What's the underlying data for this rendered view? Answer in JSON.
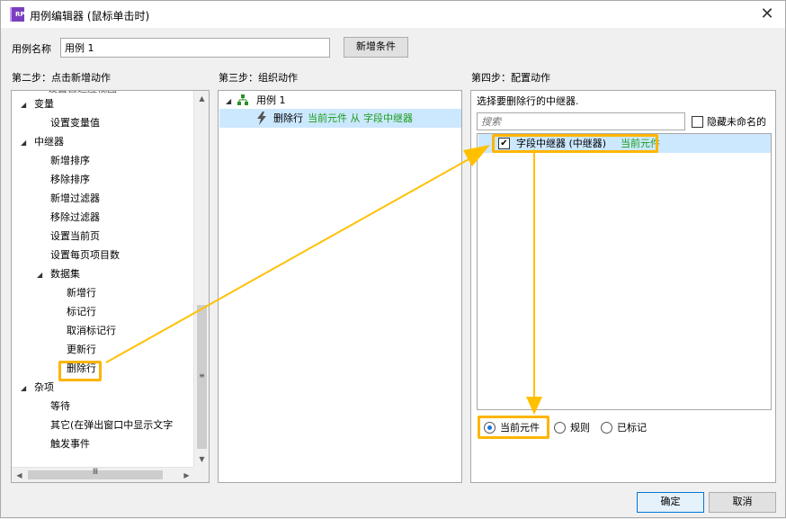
{
  "window": {
    "title": "用例编辑器 (鼠标单击时)",
    "icon_text": "RP",
    "close_glyph": "✕"
  },
  "case_name": {
    "label": "用例名称",
    "value": "用例 1"
  },
  "buttons": {
    "add_condition": "新增条件",
    "ok": "确定",
    "cancel": "取消"
  },
  "step2": {
    "heading": "第二步：点击新增动作",
    "partial_top": "设置自适应视图",
    "tree": [
      {
        "label": "变量",
        "level": 0,
        "expanded": true
      },
      {
        "label": "设置变量值",
        "level": 1
      },
      {
        "label": "中继器",
        "level": 0,
        "expanded": true
      },
      {
        "label": "新增排序",
        "level": 1
      },
      {
        "label": "移除排序",
        "level": 1
      },
      {
        "label": "新增过滤器",
        "level": 1
      },
      {
        "label": "移除过滤器",
        "level": 1
      },
      {
        "label": "设置当前页",
        "level": 1
      },
      {
        "label": "设置每页项目数",
        "level": 1
      },
      {
        "label": "数据集",
        "level": 1,
        "expanded": true
      },
      {
        "label": "新增行",
        "level": 2
      },
      {
        "label": "标记行",
        "level": 2
      },
      {
        "label": "取消标记行",
        "level": 2
      },
      {
        "label": "更新行",
        "level": 2
      },
      {
        "label": "删除行",
        "level": 2,
        "highlighted": true
      },
      {
        "label": "杂项",
        "level": 0,
        "expanded": true
      },
      {
        "label": "等待",
        "level": 1
      },
      {
        "label": "其它(在弹出窗口中显示文字",
        "level": 1
      },
      {
        "label": "触发事件",
        "level": 1
      }
    ]
  },
  "step3": {
    "heading": "第三步：组织动作",
    "case_label": "用例 1",
    "action_name": "删除行",
    "action_detail": "当前元件 从 字段中继器"
  },
  "step4": {
    "heading": "第四步：配置动作",
    "prompt": "选择要删除行的中继器.",
    "search_placeholder": "搜索",
    "hide_unnamed_label": "隐藏未命名的",
    "repeater_item": {
      "name": "字段中继器 (中继器)",
      "tag": "当前元件",
      "checked": true
    },
    "radio_options": [
      {
        "label": "当前元件",
        "selected": true
      },
      {
        "label": "规则",
        "selected": false
      },
      {
        "label": "已标记",
        "selected": false
      }
    ]
  },
  "colors": {
    "highlight": "#ffb400",
    "selection": "#cce8ff",
    "green_text": "#1a9c1a"
  }
}
